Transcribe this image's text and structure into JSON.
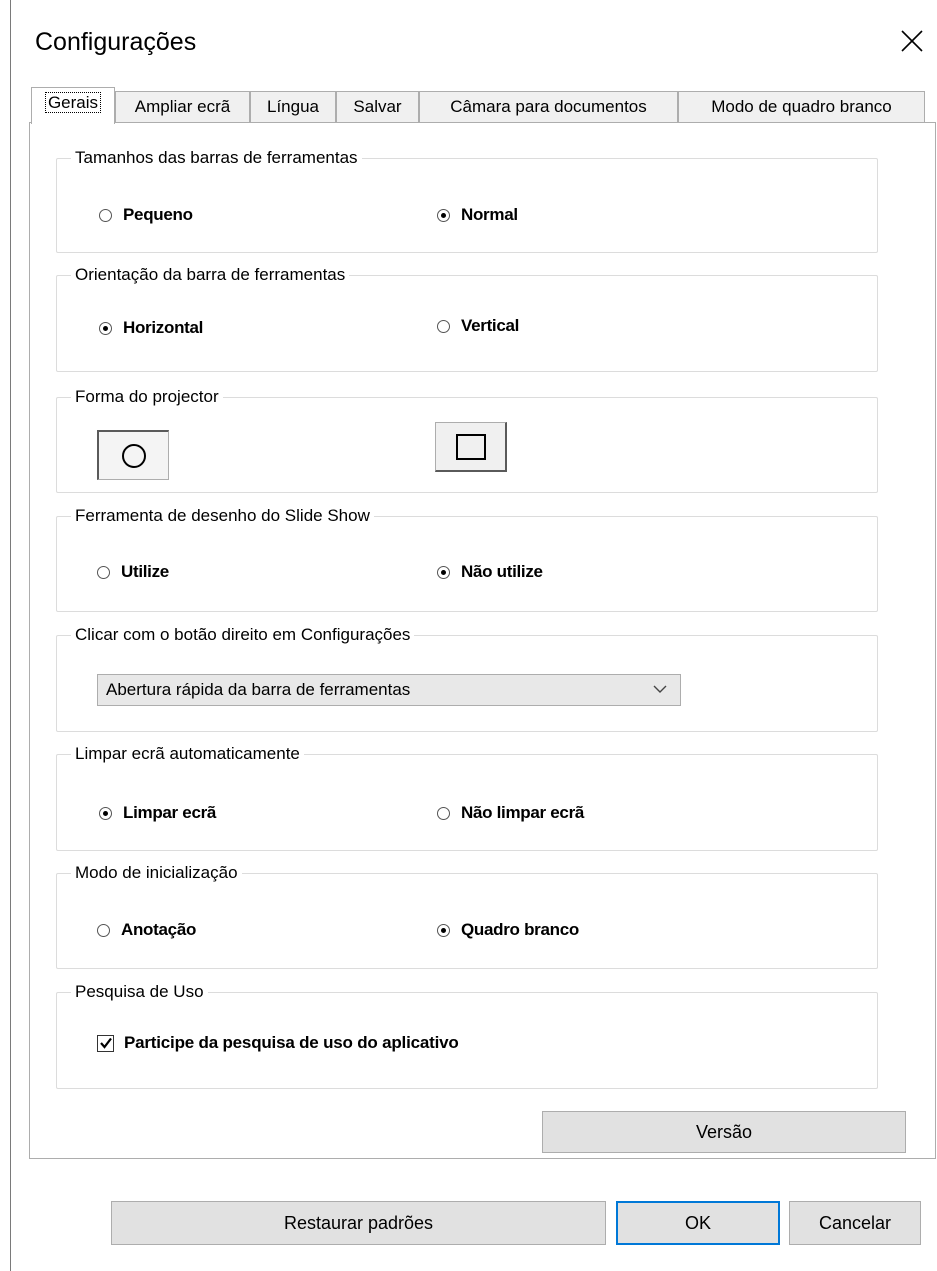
{
  "window": {
    "title": "Configurações"
  },
  "tabs": [
    {
      "label": "Gerais",
      "active": true
    },
    {
      "label": "Ampliar ecrã"
    },
    {
      "label": "Língua"
    },
    {
      "label": "Salvar"
    },
    {
      "label": "Câmara para documentos"
    },
    {
      "label": "Modo de quadro branco"
    }
  ],
  "groups": {
    "toolbar_size": {
      "legend": "Tamanhos das barras de ferramentas",
      "option1": "Pequeno",
      "option2": "Normal",
      "selected": "Normal"
    },
    "toolbar_orientation": {
      "legend": "Orientação da barra de ferramentas",
      "option1": "Horizontal",
      "option2": "Vertical",
      "selected": "Horizontal"
    },
    "projector_shape": {
      "legend": "Forma do projector",
      "selected": "circle"
    },
    "slideshow_tool": {
      "legend": "Ferramenta de desenho do Slide Show",
      "option1": "Utilize",
      "option2": "Não utilize",
      "selected": "Não utilize"
    },
    "right_click": {
      "legend": "Clicar com o botão direito em Configurações",
      "value": "Abertura rápida da barra de ferramentas"
    },
    "auto_clear": {
      "legend": "Limpar ecrã automaticamente",
      "option1": "Limpar ecrã",
      "option2": "Não limpar ecrã",
      "selected": "Limpar ecrã"
    },
    "startup_mode": {
      "legend": "Modo de inicialização",
      "option1": "Anotação",
      "option2": "Quadro branco",
      "selected": "Quadro branco"
    },
    "usage_survey": {
      "legend": "Pesquisa de Uso",
      "checkbox_label": "Participe da pesquisa de uso do aplicativo",
      "checked": true
    }
  },
  "buttons": {
    "version": "Versão",
    "restore": "Restaurar padrões",
    "ok": "OK",
    "cancel": "Cancelar"
  },
  "icons": {
    "close": "close-icon",
    "dropdown": "chevron-down-icon",
    "check": "check-icon"
  }
}
